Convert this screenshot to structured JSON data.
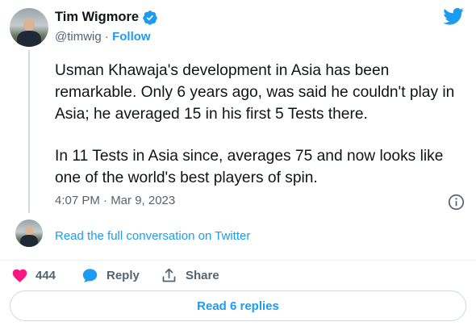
{
  "author": {
    "name": "Tim Wigmore",
    "handle": "@timwig",
    "separator": "·",
    "follow_label": "Follow"
  },
  "tweet": {
    "paragraph_1": "Usman Khawaja's development in Asia has been remarkable. Only 6 years ago, was said he couldn't play in Asia; he averaged 15 in his first 5 Tests there.",
    "paragraph_2": "In 11 Tests in Asia since, averages 75 and now looks like one of the world's best players of spin.",
    "timestamp": "4:07 PM · Mar 9, 2023"
  },
  "conversation_link": "Read the full conversation on Twitter",
  "actions": {
    "likes_count": "444",
    "reply_label": "Reply",
    "share_label": "Share"
  },
  "replies_button": "Read 6 replies",
  "colors": {
    "accent": "#1d9bf0",
    "like": "#f91880",
    "text": "#0f1419",
    "secondary": "#536471"
  },
  "icons": [
    "verified-badge-icon",
    "twitter-bird-icon",
    "info-icon",
    "heart-icon",
    "reply-bubble-icon",
    "share-icon"
  ]
}
